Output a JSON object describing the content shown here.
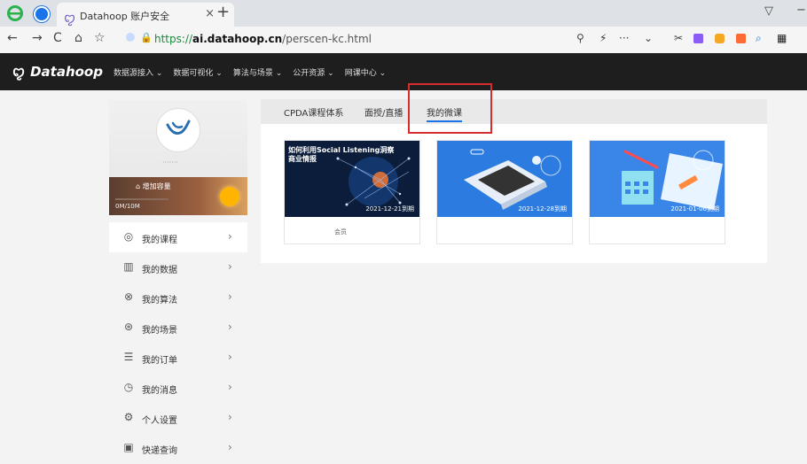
{
  "browser": {
    "tab_title": "Datahoop 账户安全",
    "tab_close": "×",
    "new_tab": "+",
    "url_protocol": "https://",
    "url_domain": "ai.datahoop.cn",
    "url_path": "/perscen-kc.html",
    "win_btn_a": "▽",
    "win_btn_b": "−",
    "nav": {
      "back": "←",
      "forward": "→",
      "reload": "C",
      "home": "⌂",
      "star": "☆"
    },
    "toolbar": {
      "zoom": "⚲",
      "flash": "⚡",
      "more": "···",
      "dropdown": "⌄",
      "cut": "✂",
      "search": "⌕",
      "apps": "▦"
    },
    "colors": {
      "secure_green": "#1b8a3a"
    }
  },
  "site": {
    "logo_text": "Datahoop",
    "nav": [
      "数据源接入",
      "数据可视化",
      "算法与场景",
      "公开资源",
      "网课中心"
    ]
  },
  "profile": {
    "username": "·······",
    "add_capacity": "增加容量",
    "storage_used": "0M/10M",
    "storage_fraction": 0.0
  },
  "sidemenu": [
    {
      "label": "我的课程",
      "icon": "course-icon",
      "glyph": "◎",
      "active": true
    },
    {
      "label": "我的数据",
      "icon": "data-chart-icon",
      "glyph": "▥",
      "active": false
    },
    {
      "label": "我的算法",
      "icon": "algorithm-icon",
      "glyph": "⊗",
      "active": false
    },
    {
      "label": "我的场景",
      "icon": "scene-icon",
      "glyph": "⊛",
      "active": false
    },
    {
      "label": "我的订单",
      "icon": "order-icon",
      "glyph": "☰",
      "active": false
    },
    {
      "label": "我的消息",
      "icon": "message-icon",
      "glyph": "◷",
      "active": false
    },
    {
      "label": "个人设置",
      "icon": "settings-icon",
      "glyph": "⚙",
      "active": false
    },
    {
      "label": "快递查询",
      "icon": "express-query-icon",
      "glyph": "▣",
      "active": false
    }
  ],
  "menu_chevron": "›",
  "content": {
    "tabs": [
      "CPDA课程体系",
      "面授/直播",
      "我的微课"
    ],
    "active_tab": 2,
    "cards": [
      {
        "title": "如何利用Social Listening洞察商业情报",
        "date": "2021-12-21到期",
        "tag": "会员",
        "bg": "#0b1d3a"
      },
      {
        "title": "",
        "date": "2021-12-28到期",
        "tag": "",
        "bg": "#2b7be0"
      },
      {
        "title": "",
        "date": "2021-01-06到期",
        "tag": "",
        "bg": "#3a86e8"
      }
    ]
  }
}
